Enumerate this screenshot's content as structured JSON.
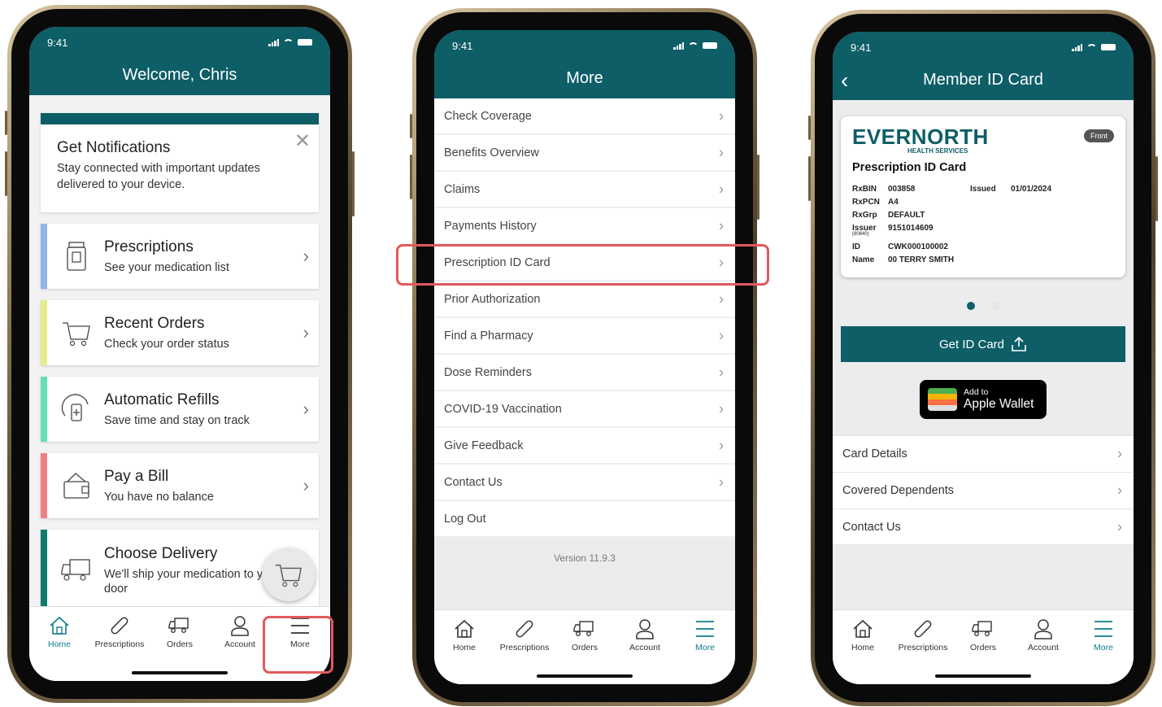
{
  "status": {
    "time": "9:41"
  },
  "phone1": {
    "title": "Welcome, Chris",
    "notification": {
      "title": "Get Notifications",
      "body": "Stay connected with important updates delivered to your device."
    },
    "cards": [
      {
        "title": "Prescriptions",
        "subtitle": "See your medication list",
        "accent": "#8fb4e8"
      },
      {
        "title": "Recent Orders",
        "subtitle": "Check your order status",
        "accent": "#e5ec8a"
      },
      {
        "title": "Automatic Refills",
        "subtitle": "Save time and stay on track",
        "accent": "#63e0b6"
      },
      {
        "title": "Pay a Bill",
        "subtitle": "You have no balance",
        "accent": "#f07f84"
      },
      {
        "title": "Choose Delivery",
        "subtitle": "We'll ship your medication to y",
        "subtitle2": "door",
        "accent": "#0d7c6c"
      }
    ]
  },
  "tabs": [
    "Home",
    "Prescriptions",
    "Orders",
    "Account",
    "More"
  ],
  "phone2": {
    "title": "More",
    "items": [
      "Check Coverage",
      "Benefits Overview",
      "Claims",
      "Payments History",
      "Prescription ID Card",
      "Prior Authorization",
      "Find a Pharmacy",
      "Dose Reminders",
      "COVID-19 Vaccination",
      "Give Feedback",
      "Contact Us",
      "Log Out"
    ],
    "version": "Version 11.9.3"
  },
  "phone3": {
    "title": "Member ID Card",
    "brand": "EVERNORTH",
    "brand_sub": "HEALTH SERVICES",
    "badge": "Front",
    "card_title": "Prescription ID Card",
    "rows": [
      {
        "k": "RxBIN",
        "v": "003858",
        "k2": "Issued",
        "v2": "01/01/2024"
      },
      {
        "k": "RxPCN",
        "v": "A4"
      },
      {
        "k": "RxGrp",
        "v": "DEFAULT"
      },
      {
        "k": "Issuer",
        "v": "9151014609",
        "note": "(80840)"
      },
      {
        "k": "ID",
        "v": "CWK000100002"
      },
      {
        "k": "Name",
        "v": "00 TERRY SMITH"
      }
    ],
    "get_id": "Get ID Card",
    "wallet_small": "Add to",
    "wallet_big": "Apple Wallet",
    "list": [
      "Card Details",
      "Covered Dependents",
      "Contact Us"
    ]
  },
  "colors": {
    "teal": "#0d5e66",
    "active_tab": "#0d7c8c",
    "highlight": "#e05a5e"
  }
}
